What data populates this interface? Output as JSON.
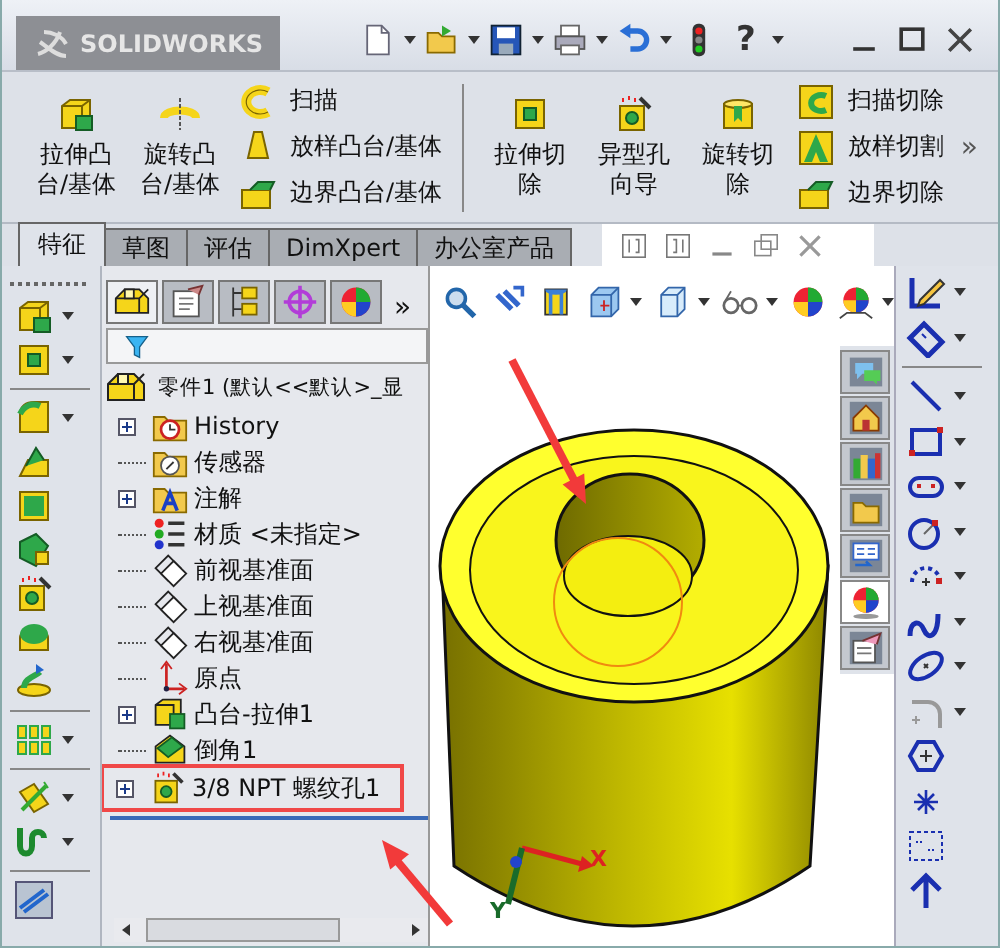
{
  "title_bar": {
    "logo": "SOLIDWORKS",
    "help": "?"
  },
  "ribbon": {
    "groups": [
      {
        "large": [
          "拉伸凸台/基体",
          "旋转凸台/基体"
        ],
        "small": [
          "扫描",
          "放样凸台/基体",
          "边界凸台/基体"
        ]
      },
      {
        "large": [
          "拉伸切除",
          "异型孔向导",
          "旋转切除"
        ],
        "small": [
          "扫描切除",
          "放样切割",
          "边界切除"
        ]
      }
    ],
    "more": "»"
  },
  "tabs": [
    {
      "label": "特征",
      "selected": true
    },
    {
      "label": "草图",
      "selected": false
    },
    {
      "label": "评估",
      "selected": false
    },
    {
      "label": "DimXpert",
      "selected": false
    },
    {
      "label": "办公室产品",
      "selected": false
    }
  ],
  "feature_panel": {
    "more": "»",
    "root": "零件1 (默认<<默认>_显",
    "items": [
      {
        "label": "History",
        "kind": "history",
        "expandable": true,
        "annotated": false
      },
      {
        "label": "传感器",
        "kind": "sensor",
        "expandable": false,
        "annotated": false
      },
      {
        "label": "注解",
        "kind": "annotation",
        "expandable": true,
        "annotated": false
      },
      {
        "label": "材质 <未指定>",
        "kind": "material",
        "expandable": false,
        "annotated": false
      },
      {
        "label": "前视基准面",
        "kind": "plane",
        "expandable": false,
        "annotated": false
      },
      {
        "label": "上视基准面",
        "kind": "plane",
        "expandable": false,
        "annotated": false
      },
      {
        "label": "右视基准面",
        "kind": "plane",
        "expandable": false,
        "annotated": false
      },
      {
        "label": "原点",
        "kind": "origin",
        "expandable": false,
        "annotated": false
      },
      {
        "label": "凸台-拉伸1",
        "kind": "extrude",
        "expandable": true,
        "annotated": false
      },
      {
        "label": "倒角1",
        "kind": "chamfer",
        "expandable": false,
        "annotated": false
      },
      {
        "label": "3/8 NPT 螺纹孔1",
        "kind": "hole",
        "expandable": true,
        "annotated": true
      }
    ]
  },
  "task_pane_tabs": [
    {
      "selected": false
    },
    {
      "selected": false
    },
    {
      "selected": false
    },
    {
      "selected": false
    },
    {
      "selected": false
    },
    {
      "selected": true
    },
    {
      "selected": false
    }
  ],
  "viewport": {
    "triad": {
      "x": "X",
      "y": "Y"
    }
  }
}
